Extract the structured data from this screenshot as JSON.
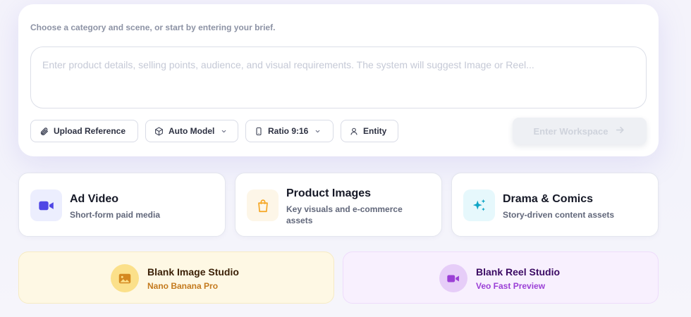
{
  "brief": {
    "hint": "Choose a category and scene, or start by entering your brief.",
    "placeholder": "Enter product details, selling points, audience, and visual requirements. The system will suggest Image or Reel...",
    "value": ""
  },
  "toolbar": {
    "upload_label": "Upload Reference",
    "model_label": "Auto Model",
    "ratio_label": "Ratio 9:16",
    "entity_label": "Entity",
    "enter_label": "Enter Workspace"
  },
  "categories": [
    {
      "title": "Ad Video",
      "subtitle": "Short-form paid media",
      "icon": "video-camera-icon",
      "accent": "#4f46e5"
    },
    {
      "title": "Product Images",
      "subtitle": "Key visuals and e-commerce assets",
      "icon": "shopping-bag-icon",
      "accent": "#f5a623"
    },
    {
      "title": "Drama & Comics",
      "subtitle": "Story-driven content assets",
      "icon": "sparkles-icon",
      "accent": "#0ea5c6"
    }
  ],
  "studios": [
    {
      "title": "Blank Image Studio",
      "subtitle": "Nano Banana Pro",
      "icon": "image-icon",
      "accent": "#d4881f"
    },
    {
      "title": "Blank Reel Studio",
      "subtitle": "Veo Fast Preview",
      "icon": "video-camera-icon",
      "accent": "#9b3fd6"
    }
  ]
}
